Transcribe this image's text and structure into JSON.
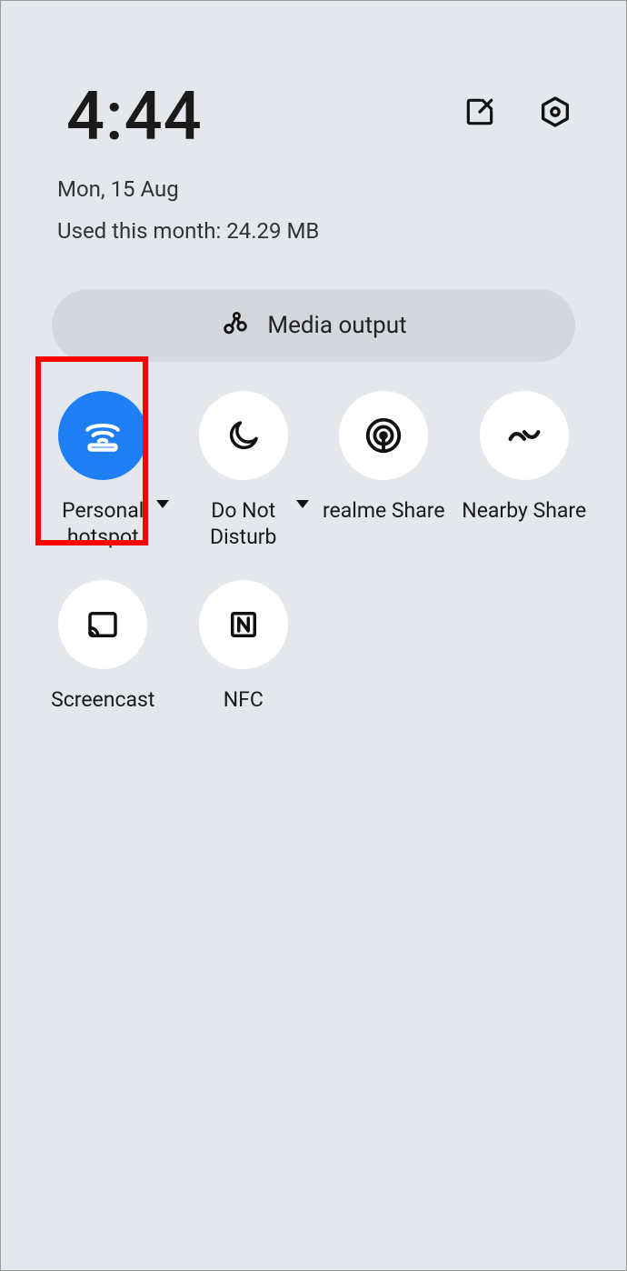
{
  "header": {
    "time": "4:44",
    "date": "Mon, 15 Aug",
    "usage": "Used this month: 24.29 MB"
  },
  "media": {
    "label": "Media output"
  },
  "tiles": [
    {
      "label": "Personal hotspot"
    },
    {
      "label": "Do Not Disturb"
    },
    {
      "label": "realme Share"
    },
    {
      "label": "Nearby Share"
    },
    {
      "label": "Screencast"
    },
    {
      "label": "NFC"
    }
  ]
}
